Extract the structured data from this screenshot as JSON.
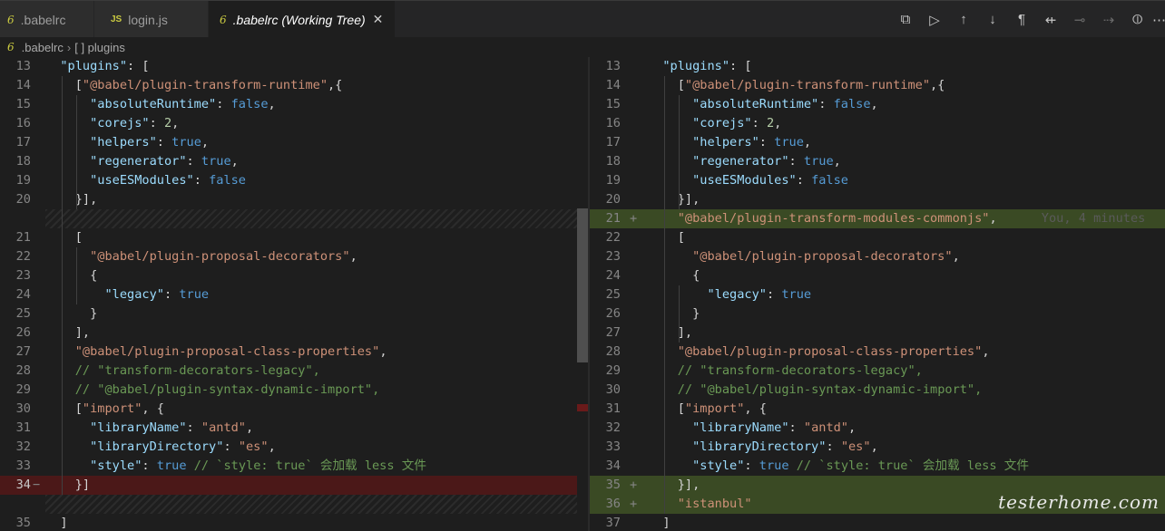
{
  "tabs": [
    {
      "label": ".babelrc",
      "icon": "babel-icon",
      "active": false
    },
    {
      "label": "login.js",
      "icon": "js-icon",
      "active": false
    },
    {
      "label": ".babelrc (Working Tree)",
      "icon": "babel-icon",
      "active": true
    }
  ],
  "tab_icons": {
    "babel": "6",
    "js": "JS"
  },
  "breadcrumb": {
    "file": ".babelrc",
    "node": "[ ] plugins"
  },
  "toolbar_icons": [
    "open-changes-icon",
    "run-icon",
    "previous-change-icon",
    "next-change-icon",
    "whitespace-icon",
    "compare-icon",
    "git-commit-icon",
    "forward-icon",
    "gitlens-icon",
    "more-icon"
  ],
  "watermark": "testerhome.com",
  "left_lines": [
    {
      "n": "13",
      "tokens": [
        [
          "p",
          "  "
        ],
        [
          "k",
          "\"plugins\""
        ],
        [
          "p",
          ": ["
        ]
      ]
    },
    {
      "n": "14",
      "tokens": [
        [
          "p",
          "    ["
        ],
        [
          "s",
          "\"@babel/plugin-transform-runtime\""
        ],
        [
          "p",
          ",{"
        ]
      ]
    },
    {
      "n": "15",
      "tokens": [
        [
          "p",
          "      "
        ],
        [
          "k",
          "\"absoluteRuntime\""
        ],
        [
          "p",
          ": "
        ],
        [
          "b",
          "false"
        ],
        [
          "p",
          ","
        ]
      ]
    },
    {
      "n": "16",
      "tokens": [
        [
          "p",
          "      "
        ],
        [
          "k",
          "\"corejs\""
        ],
        [
          "p",
          ": "
        ],
        [
          "n",
          "2"
        ],
        [
          "p",
          ","
        ]
      ]
    },
    {
      "n": "17",
      "tokens": [
        [
          "p",
          "      "
        ],
        [
          "k",
          "\"helpers\""
        ],
        [
          "p",
          ": "
        ],
        [
          "b",
          "true"
        ],
        [
          "p",
          ","
        ]
      ]
    },
    {
      "n": "18",
      "tokens": [
        [
          "p",
          "      "
        ],
        [
          "k",
          "\"regenerator\""
        ],
        [
          "p",
          ": "
        ],
        [
          "b",
          "true"
        ],
        [
          "p",
          ","
        ]
      ]
    },
    {
      "n": "19",
      "tokens": [
        [
          "p",
          "      "
        ],
        [
          "k",
          "\"useESModules\""
        ],
        [
          "p",
          ": "
        ],
        [
          "b",
          "false"
        ]
      ]
    },
    {
      "n": "20",
      "tokens": [
        [
          "p",
          "    }],"
        ]
      ]
    },
    {
      "filler": true
    },
    {
      "n": "21",
      "tokens": [
        [
          "p",
          "    ["
        ]
      ]
    },
    {
      "n": "22",
      "tokens": [
        [
          "p",
          "      "
        ],
        [
          "s",
          "\"@babel/plugin-proposal-decorators\""
        ],
        [
          "p",
          ","
        ]
      ]
    },
    {
      "n": "23",
      "tokens": [
        [
          "p",
          "      {"
        ]
      ]
    },
    {
      "n": "24",
      "tokens": [
        [
          "p",
          "        "
        ],
        [
          "k",
          "\"legacy\""
        ],
        [
          "p",
          ": "
        ],
        [
          "b",
          "true"
        ]
      ]
    },
    {
      "n": "25",
      "tokens": [
        [
          "p",
          "      }"
        ]
      ]
    },
    {
      "n": "26",
      "tokens": [
        [
          "p",
          "    ],"
        ]
      ]
    },
    {
      "n": "27",
      "tokens": [
        [
          "p",
          "    "
        ],
        [
          "s",
          "\"@babel/plugin-proposal-class-properties\""
        ],
        [
          "p",
          ","
        ]
      ]
    },
    {
      "n": "28",
      "tokens": [
        [
          "p",
          "    "
        ],
        [
          "c",
          "// \"transform-decorators-legacy\","
        ]
      ]
    },
    {
      "n": "29",
      "tokens": [
        [
          "p",
          "    "
        ],
        [
          "c",
          "// \"@babel/plugin-syntax-dynamic-import\","
        ]
      ]
    },
    {
      "n": "30",
      "tokens": [
        [
          "p",
          "    ["
        ],
        [
          "s",
          "\"import\""
        ],
        [
          "p",
          ", {"
        ]
      ]
    },
    {
      "n": "31",
      "tokens": [
        [
          "p",
          "      "
        ],
        [
          "k",
          "\"libraryName\""
        ],
        [
          "p",
          ": "
        ],
        [
          "s",
          "\"antd\""
        ],
        [
          "p",
          ","
        ]
      ]
    },
    {
      "n": "32",
      "tokens": [
        [
          "p",
          "      "
        ],
        [
          "k",
          "\"libraryDirectory\""
        ],
        [
          "p",
          ": "
        ],
        [
          "s",
          "\"es\""
        ],
        [
          "p",
          ","
        ]
      ]
    },
    {
      "n": "33",
      "tokens": [
        [
          "p",
          "      "
        ],
        [
          "k",
          "\"style\""
        ],
        [
          "p",
          ": "
        ],
        [
          "b",
          "true"
        ],
        [
          "p",
          " "
        ],
        [
          "c",
          "// `style: true` 会加载 less 文件"
        ]
      ]
    },
    {
      "n": "34",
      "mark": "−",
      "type": "del",
      "tokens": [
        [
          "p",
          "    }]"
        ]
      ]
    },
    {
      "filler": true
    },
    {
      "n": "35",
      "tokens": [
        [
          "p",
          "  ]"
        ]
      ]
    }
  ],
  "right_lines": [
    {
      "n": "13",
      "tokens": [
        [
          "p",
          "  "
        ],
        [
          "k",
          "\"plugins\""
        ],
        [
          "p",
          ": ["
        ]
      ]
    },
    {
      "n": "14",
      "tokens": [
        [
          "p",
          "    ["
        ],
        [
          "s",
          "\"@babel/plugin-transform-runtime\""
        ],
        [
          "p",
          ",{"
        ]
      ]
    },
    {
      "n": "15",
      "tokens": [
        [
          "p",
          "      "
        ],
        [
          "k",
          "\"absoluteRuntime\""
        ],
        [
          "p",
          ": "
        ],
        [
          "b",
          "false"
        ],
        [
          "p",
          ","
        ]
      ]
    },
    {
      "n": "16",
      "tokens": [
        [
          "p",
          "      "
        ],
        [
          "k",
          "\"corejs\""
        ],
        [
          "p",
          ": "
        ],
        [
          "n",
          "2"
        ],
        [
          "p",
          ","
        ]
      ]
    },
    {
      "n": "17",
      "tokens": [
        [
          "p",
          "      "
        ],
        [
          "k",
          "\"helpers\""
        ],
        [
          "p",
          ": "
        ],
        [
          "b",
          "true"
        ],
        [
          "p",
          ","
        ]
      ]
    },
    {
      "n": "18",
      "tokens": [
        [
          "p",
          "      "
        ],
        [
          "k",
          "\"regenerator\""
        ],
        [
          "p",
          ": "
        ],
        [
          "b",
          "true"
        ],
        [
          "p",
          ","
        ]
      ]
    },
    {
      "n": "19",
      "tokens": [
        [
          "p",
          "      "
        ],
        [
          "k",
          "\"useESModules\""
        ],
        [
          "p",
          ": "
        ],
        [
          "b",
          "false"
        ]
      ]
    },
    {
      "n": "20",
      "tokens": [
        [
          "p",
          "    }],"
        ]
      ]
    },
    {
      "n": "21",
      "mark": "+",
      "type": "ins",
      "tokens": [
        [
          "p",
          "    "
        ],
        [
          "s",
          "\"@babel/plugin-transform-modules-commonjs\""
        ],
        [
          "p",
          ","
        ],
        [
          "blame",
          "      You, 4 minutes"
        ]
      ]
    },
    {
      "n": "22",
      "tokens": [
        [
          "p",
          "    ["
        ]
      ]
    },
    {
      "n": "23",
      "tokens": [
        [
          "p",
          "      "
        ],
        [
          "s",
          "\"@babel/plugin-proposal-decorators\""
        ],
        [
          "p",
          ","
        ]
      ]
    },
    {
      "n": "24",
      "tokens": [
        [
          "p",
          "      {"
        ]
      ]
    },
    {
      "n": "25",
      "tokens": [
        [
          "p",
          "        "
        ],
        [
          "k",
          "\"legacy\""
        ],
        [
          "p",
          ": "
        ],
        [
          "b",
          "true"
        ]
      ]
    },
    {
      "n": "26",
      "tokens": [
        [
          "p",
          "      }"
        ]
      ]
    },
    {
      "n": "27",
      "tokens": [
        [
          "p",
          "    ],"
        ]
      ]
    },
    {
      "n": "28",
      "tokens": [
        [
          "p",
          "    "
        ],
        [
          "s",
          "\"@babel/plugin-proposal-class-properties\""
        ],
        [
          "p",
          ","
        ]
      ]
    },
    {
      "n": "29",
      "tokens": [
        [
          "p",
          "    "
        ],
        [
          "c",
          "// \"transform-decorators-legacy\","
        ]
      ]
    },
    {
      "n": "30",
      "tokens": [
        [
          "p",
          "    "
        ],
        [
          "c",
          "// \"@babel/plugin-syntax-dynamic-import\","
        ]
      ]
    },
    {
      "n": "31",
      "tokens": [
        [
          "p",
          "    ["
        ],
        [
          "s",
          "\"import\""
        ],
        [
          "p",
          ", {"
        ]
      ]
    },
    {
      "n": "32",
      "tokens": [
        [
          "p",
          "      "
        ],
        [
          "k",
          "\"libraryName\""
        ],
        [
          "p",
          ": "
        ],
        [
          "s",
          "\"antd\""
        ],
        [
          "p",
          ","
        ]
      ]
    },
    {
      "n": "33",
      "tokens": [
        [
          "p",
          "      "
        ],
        [
          "k",
          "\"libraryDirectory\""
        ],
        [
          "p",
          ": "
        ],
        [
          "s",
          "\"es\""
        ],
        [
          "p",
          ","
        ]
      ]
    },
    {
      "n": "34",
      "tokens": [
        [
          "p",
          "      "
        ],
        [
          "k",
          "\"style\""
        ],
        [
          "p",
          ": "
        ],
        [
          "b",
          "true"
        ],
        [
          "p",
          " "
        ],
        [
          "c",
          "// `style: true` 会加载 less 文件"
        ]
      ]
    },
    {
      "n": "35",
      "mark": "+",
      "type": "ins",
      "tokens": [
        [
          "p",
          "    }],"
        ]
      ]
    },
    {
      "n": "36",
      "mark": "+",
      "type": "ins",
      "tokens": [
        [
          "p",
          "    "
        ],
        [
          "s",
          "\"istanbul\""
        ]
      ]
    },
    {
      "n": "37",
      "tokens": [
        [
          "p",
          "  ]"
        ]
      ]
    }
  ]
}
